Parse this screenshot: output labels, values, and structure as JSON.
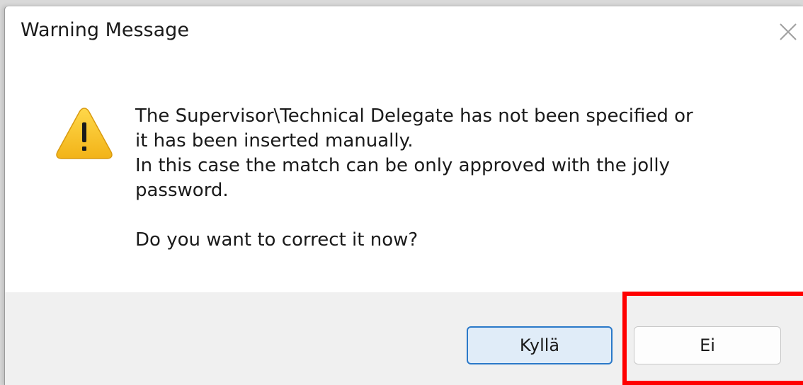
{
  "dialog": {
    "title": "Warning Message",
    "icon": "warning-icon",
    "message_lines": [
      "The Supervisor\\Technical Delegate has not been specified or",
      "it has been inserted manually.",
      "In this case the match can be only approved with the jolly",
      "password."
    ],
    "question": "Do you want to correct it now?",
    "buttons": {
      "yes_label": "Kyllä",
      "no_label": "Ei"
    }
  },
  "annotation": {
    "highlight_color": "#ff0000",
    "highlight_target": "no-button"
  },
  "colors": {
    "warning_yellow": "#f7c325",
    "default_button_border": "#2b79c9",
    "footer_bg": "#f0f0f0"
  }
}
